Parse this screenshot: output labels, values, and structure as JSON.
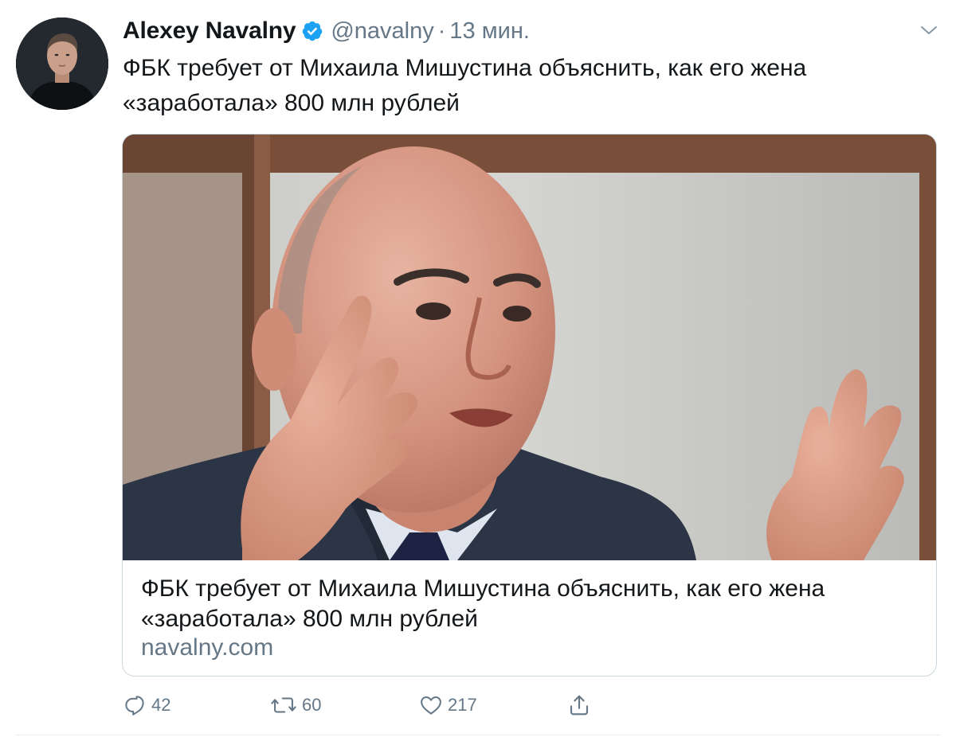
{
  "author": {
    "name": "Alexey Navalny",
    "handle": "@navalny",
    "separator": "·",
    "time": "13 мин."
  },
  "icons": {
    "verified": "verified-badge-icon",
    "more": "chevron-down-icon",
    "reply": "reply-icon",
    "retweet": "retweet-icon",
    "like": "heart-icon",
    "share": "share-icon"
  },
  "colors": {
    "verified": "#1da1f2",
    "secondary_text": "#657786",
    "border": "#ccd6dd"
  },
  "tweet": {
    "text": "ФБК требует от Михаила Мишустина объяснить, как его жена «заработала» 800 млн рублей"
  },
  "card": {
    "title": "ФБК требует от Михаила Мишустина объяснить, как его жена «заработала» 800 млн рублей",
    "domain": "navalny.com"
  },
  "actions": {
    "replies": "42",
    "retweets": "60",
    "likes": "217"
  }
}
